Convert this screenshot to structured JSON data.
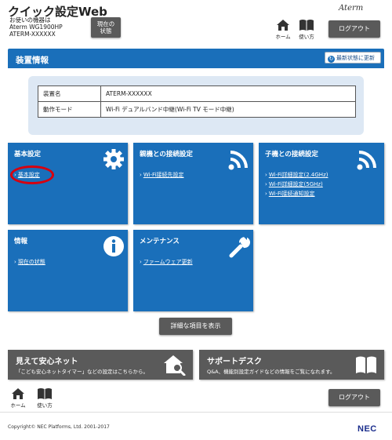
{
  "header": {
    "app_title": "クイック設定Web",
    "device_line1": "お使いの機器は",
    "device_line2": "Aterm WG1900HP",
    "device_line3": "ATERM-XXXXXX",
    "status_line1": "現在の",
    "status_line2": "状態",
    "brand": "Aterm",
    "home_label": "ホーム",
    "manual_label": "使い方",
    "logout_label": "ログアウト"
  },
  "device_panel": {
    "title": "装置情報",
    "refresh_label": "最新状態に更新",
    "rows": [
      {
        "key": "装置名",
        "value": "ATERM-XXXXXX"
      },
      {
        "key": "動作モード",
        "value": "Wi-Fi デュアルバンド中継(Wi-Fi TV モード中継)"
      }
    ]
  },
  "tiles": {
    "basic": {
      "title": "基本設定",
      "links": [
        "基本設定"
      ],
      "icon": "gear-icon"
    },
    "parent": {
      "title": "親機との接続設定",
      "links": [
        "Wi-Fi接続先設定"
      ],
      "icon": "wifi-icon"
    },
    "child": {
      "title": "子機との接続設定",
      "links": [
        "Wi-Fi詳細設定(2.4GHz)",
        "Wi-Fi詳細設定(5GHz)",
        "Wi-Fi接続通知設定"
      ],
      "icon": "wifi-icon"
    },
    "info": {
      "title": "情報",
      "links": [
        "現在の状態"
      ],
      "icon": "info-icon"
    },
    "maint": {
      "title": "メンテナンス",
      "links": [
        "ファームウェア更新"
      ],
      "icon": "wrench-icon"
    }
  },
  "detail_button": "詳細な項目を表示",
  "banners": {
    "mimamori": {
      "title": "見えて安心ネット",
      "sub": "「こども安心ネットタイマー」などの設定はこちらから。"
    },
    "support": {
      "title": "サポートデスク",
      "sub": "Q&A、機能別設定ガイドなどの情報をご覧になれます。"
    }
  },
  "footer": {
    "home_label": "ホーム",
    "manual_label": "使い方",
    "logout_label": "ログアウト",
    "copyright": "Copyright© NEC Platforms, Ltd. 2001-2017",
    "logo": "NEC"
  },
  "colors": {
    "accent": "#1a6fba",
    "button": "#5a5a5a",
    "highlight": "#d7000f"
  }
}
